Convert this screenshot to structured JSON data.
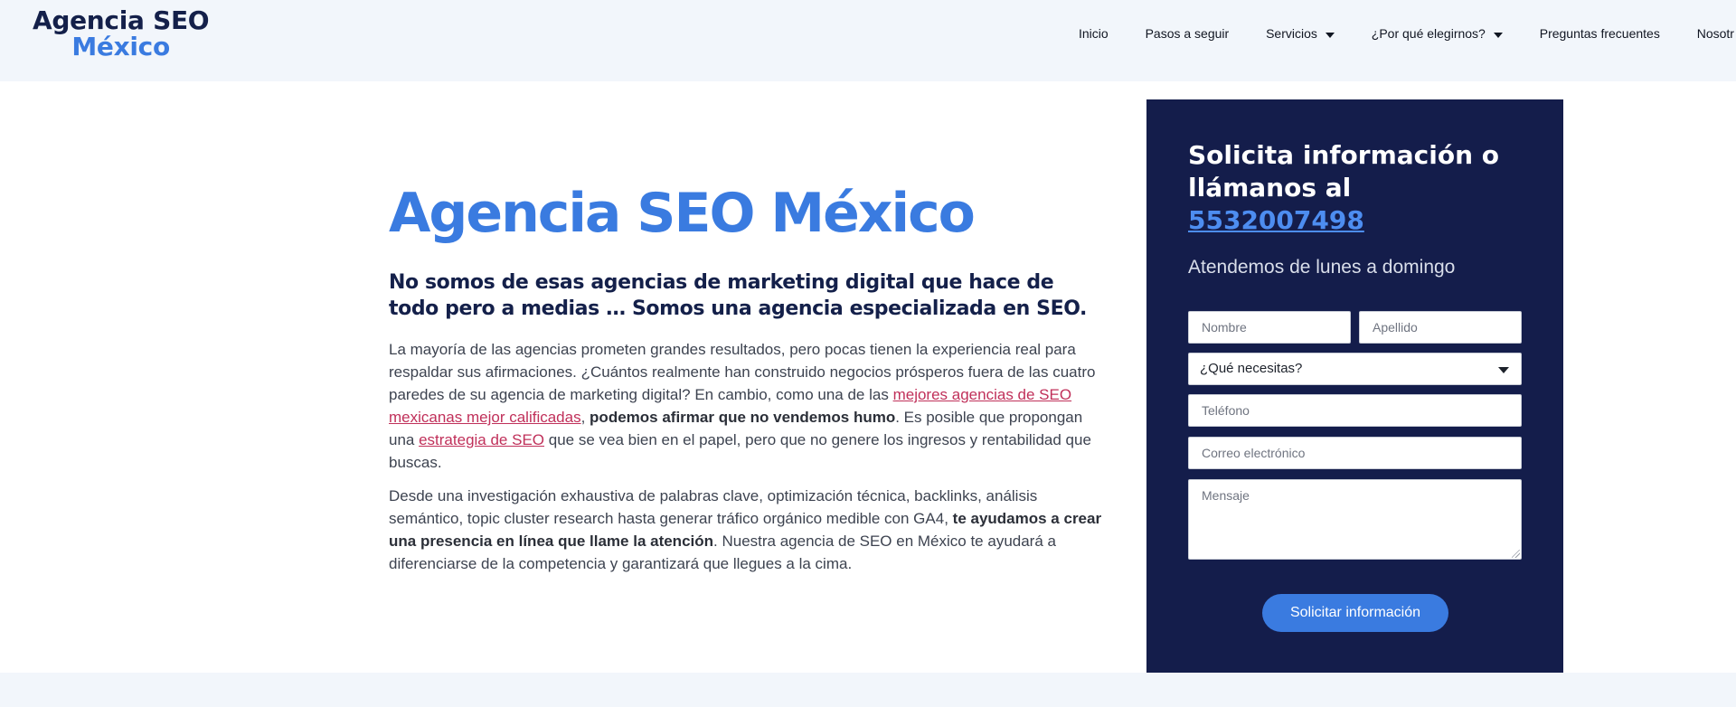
{
  "header": {
    "logo_line1": "Agencia SEO",
    "logo_line2": "México",
    "nav": [
      {
        "label": "Inicio",
        "has_caret": false
      },
      {
        "label": "Pasos a seguir",
        "has_caret": false
      },
      {
        "label": "Servicios",
        "has_caret": true
      },
      {
        "label": "¿Por qué elegirnos?",
        "has_caret": true
      },
      {
        "label": "Preguntas frecuentes",
        "has_caret": false
      },
      {
        "label": "Nosotr",
        "has_caret": false
      }
    ]
  },
  "main": {
    "title": "Agencia SEO México",
    "subtitle": "No somos de esas agencias de marketing digital que hace de todo pero a medias … Somos una agencia especializada en SEO.",
    "para1": {
      "t1": "La mayoría de las agencias prometen grandes resultados, pero pocas tienen la experiencia real para respaldar sus afirmaciones. ¿Cuántos realmente han construido negocios prósperos fuera de las cuatro paredes de su agencia de marketing digital? En cambio, como una de las ",
      "link1": "mejores agencias de SEO mexicanas mejor calificadas",
      "t2": ", ",
      "bold1": "podemos afirmar que no vendemos humo",
      "t3": ". Es posible que propongan una ",
      "link2": "estrategia de SEO",
      "t4": " que se vea bien en el papel, pero que no genere los ingresos y rentabilidad que buscas."
    },
    "para2": {
      "t1": "Desde una investigación exhaustiva de palabras clave, optimización técnica, backlinks, análisis semántico, topic cluster research hasta generar tráfico orgánico medible con GA4, ",
      "bold1": "te ayudamos a crear una presencia en línea que llame la atención",
      "t2": ". Nuestra agencia de SEO en México te ayudará a diferenciarse de la competencia y garantizará que llegues a la cima."
    }
  },
  "form": {
    "title_text": "Solicita información o llámanos al ",
    "phone": "5532007498",
    "subtitle": "Atendemos de lunes a domingo",
    "name_placeholder": "Nombre",
    "lastname_placeholder": "Apellido",
    "need_select": "¿Qué necesitas?",
    "phone_placeholder": "Teléfono",
    "email_placeholder": "Correo electrónico",
    "message_placeholder": "Mensaje",
    "submit_label": "Solicitar información"
  },
  "colors": {
    "brand_blue": "#3a7be0",
    "navy": "#141d4b",
    "link_red": "#c0305a",
    "header_bg": "#f2f6fb"
  }
}
